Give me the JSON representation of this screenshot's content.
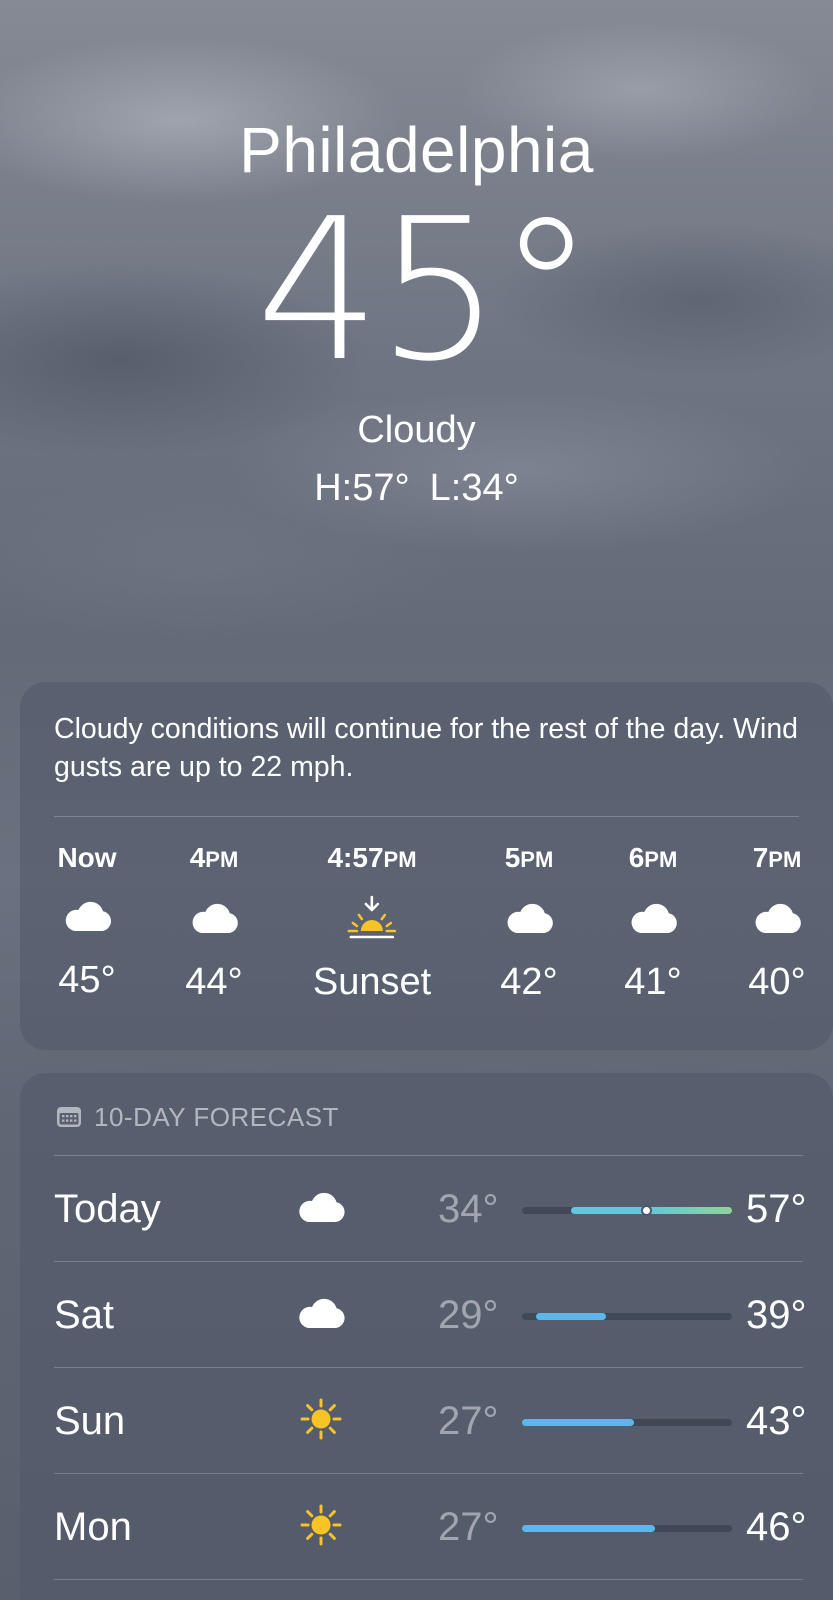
{
  "location": {
    "city": "Philadelphia",
    "temperature": "45°",
    "condition": "Cloudy",
    "high": "H:57°",
    "low": "L:34°"
  },
  "hourly": {
    "summary": "Cloudy conditions will continue for the rest of the day. Wind gusts are up to 22 mph.",
    "items": [
      {
        "time": "Now",
        "suffix": "",
        "icon": "cloud-icon",
        "value": "45°"
      },
      {
        "time": "4",
        "suffix": "PM",
        "icon": "cloud-icon",
        "value": "44°"
      },
      {
        "time": "4:57",
        "suffix": "PM",
        "icon": "sunset-icon",
        "value": "Sunset"
      },
      {
        "time": "5",
        "suffix": "PM",
        "icon": "cloud-icon",
        "value": "42°"
      },
      {
        "time": "6",
        "suffix": "PM",
        "icon": "cloud-icon",
        "value": "41°"
      },
      {
        "time": "7",
        "suffix": "PM",
        "icon": "cloud-icon",
        "value": "40°"
      }
    ]
  },
  "forecast": {
    "title": "10-DAY FORECAST",
    "icon": "calendar-icon",
    "range_min": 27,
    "range_max": 57,
    "current_temp": 45,
    "days": [
      {
        "day": "Today",
        "icon": "cloud-icon",
        "low": "34°",
        "high": "57°",
        "low_value": 34,
        "high_value": 57
      },
      {
        "day": "Sat",
        "icon": "cloud-icon",
        "low": "29°",
        "high": "39°",
        "low_value": 29,
        "high_value": 39
      },
      {
        "day": "Sun",
        "icon": "sun-icon",
        "low": "27°",
        "high": "43°",
        "low_value": 27,
        "high_value": 43
      },
      {
        "day": "Mon",
        "icon": "sun-icon",
        "low": "27°",
        "high": "46°",
        "low_value": 27,
        "high_value": 46
      }
    ]
  },
  "colors": {
    "sun": "#f7c325",
    "bar_cool": "#5ab8ee",
    "bar_warm": "#8ed39b",
    "bar_teal": "#62c6dc"
  }
}
